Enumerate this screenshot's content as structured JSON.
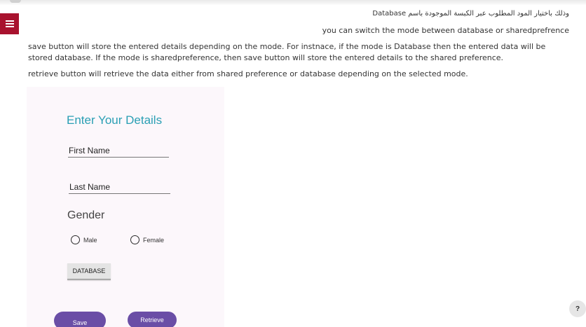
{
  "header": {
    "arabic_text": "وذلك باختيار المود المطلوب عبر الكبسة الموجودة باسم Database",
    "menu_icon": "list-icon"
  },
  "content": {
    "switch_mode": "you can switch the mode between database or sharedprefrence",
    "save_explanation": "save button will store the entered details depending on the mode. For instnace, if the mode is Database then the entered data will be stored database. If the mode is sharedpreference, then save button will store the entered details to the shared preference.",
    "retrieve_explanation": "retrieve button will retrieve the data either from shared preference or database depending on the selected mode."
  },
  "form": {
    "title": "Enter Your Details",
    "first_name": "First Name",
    "last_name": "Last Name",
    "gender_label": "Gender",
    "gender_options": [
      "Male",
      "Female"
    ],
    "mode_button": "DATABASE",
    "save_button": "Save",
    "retrieve_button": "Retrieve"
  },
  "help": {
    "label": "?"
  },
  "colors": {
    "menu_tab": "#a8122e",
    "title": "#2a9fb4",
    "buttons": "#6a4ea6",
    "phone_background": "#fcf7fb"
  }
}
